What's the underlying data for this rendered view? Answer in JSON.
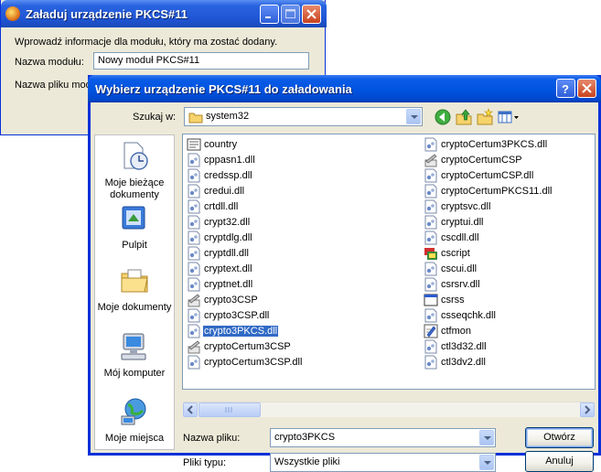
{
  "back_window": {
    "title": "Załaduj urządzenie PKCS#11",
    "info_text": "Wprowadź informacje dla modułu, który ma zostać dodany.",
    "module_name_label": "Nazwa modułu:",
    "module_name_value": "Nowy moduł PKCS#11",
    "module_file_label": "Nazwa pliku modułu:"
  },
  "dialog": {
    "title": "Wybierz urządzenie PKCS#11 do załadowania",
    "look_in_label": "Szukaj w:",
    "look_in_value": "system32",
    "places": [
      {
        "label": "Moje bieżące dokumenty",
        "icon": "recent-documents-icon"
      },
      {
        "label": "Pulpit",
        "icon": "desktop-icon"
      },
      {
        "label": "Moje dokumenty",
        "icon": "my-documents-icon"
      },
      {
        "label": "Mój komputer",
        "icon": "my-computer-icon"
      },
      {
        "label": "Moje miejsca",
        "icon": "network-places-icon"
      }
    ],
    "files_col1": [
      {
        "name": "country",
        "icon": "file-icon"
      },
      {
        "name": "cppasn1.dll",
        "icon": "dll-icon"
      },
      {
        "name": "credssp.dll",
        "icon": "dll-icon"
      },
      {
        "name": "credui.dll",
        "icon": "dll-icon"
      },
      {
        "name": "crtdll.dll",
        "icon": "dll-icon"
      },
      {
        "name": "crypt32.dll",
        "icon": "dll-icon"
      },
      {
        "name": "cryptdlg.dll",
        "icon": "dll-icon"
      },
      {
        "name": "cryptdll.dll",
        "icon": "dll-icon"
      },
      {
        "name": "cryptext.dll",
        "icon": "dll-icon"
      },
      {
        "name": "cryptnet.dll",
        "icon": "dll-icon"
      },
      {
        "name": "crypto3CSP",
        "icon": "tool-icon"
      },
      {
        "name": "crypto3CSP.dll",
        "icon": "dll-icon"
      },
      {
        "name": "crypto3PKCS.dll",
        "icon": "dll-icon",
        "selected": true
      },
      {
        "name": "cryptoCertum3CSP",
        "icon": "tool-icon"
      },
      {
        "name": "cryptoCertum3CSP.dll",
        "icon": "dll-icon"
      }
    ],
    "files_col2": [
      {
        "name": "cryptoCertum3PKCS.dll",
        "icon": "dll-icon"
      },
      {
        "name": "cryptoCertumCSP",
        "icon": "tool-icon"
      },
      {
        "name": "cryptoCertumCSP.dll",
        "icon": "dll-icon"
      },
      {
        "name": "cryptoCertumPKCS11.dll",
        "icon": "dll-icon"
      },
      {
        "name": "cryptsvc.dll",
        "icon": "dll-icon"
      },
      {
        "name": "cryptui.dll",
        "icon": "dll-icon"
      },
      {
        "name": "cscdll.dll",
        "icon": "dll-icon"
      },
      {
        "name": "cscript",
        "icon": "script-icon"
      },
      {
        "name": "cscui.dll",
        "icon": "dll-icon"
      },
      {
        "name": "csrsrv.dll",
        "icon": "dll-icon"
      },
      {
        "name": "csrss",
        "icon": "window-icon"
      },
      {
        "name": "csseqchk.dll",
        "icon": "dll-icon"
      },
      {
        "name": "ctfmon",
        "icon": "pen-icon"
      },
      {
        "name": "ctl3d32.dll",
        "icon": "dll-icon"
      },
      {
        "name": "ctl3dv2.dll",
        "icon": "dll-icon"
      }
    ],
    "file_name_label": "Nazwa pliku:",
    "file_name_value": "crypto3PKCS",
    "file_type_label": "Pliki typu:",
    "file_type_value": "Wszystkie pliki",
    "open_button": "Otwórz",
    "cancel_button": "Anuluj"
  }
}
